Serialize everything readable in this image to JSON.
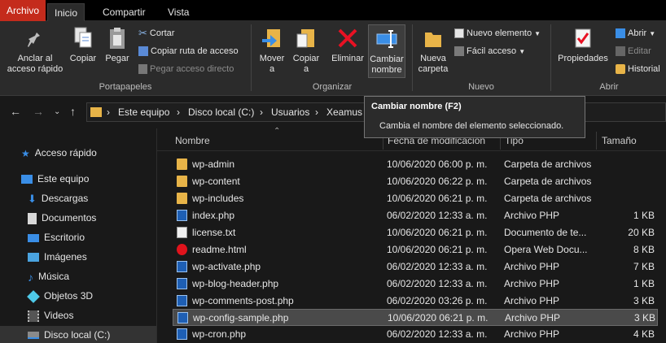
{
  "tabs": [
    "Archivo",
    "Inicio",
    "Compartir",
    "Vista"
  ],
  "ribbon": {
    "portapapeles": {
      "label": "Portapapeles",
      "anclar": "Anclar al acceso rápido",
      "copiar": "Copiar",
      "pegar": "Pegar",
      "cortar": "Cortar",
      "copiar_ruta": "Copiar ruta de acceso",
      "pegar_directo": "Pegar acceso directo"
    },
    "organizar": {
      "label": "Organizar",
      "mover": "Mover a",
      "copiar_a": "Copiar a",
      "eliminar": "Eliminar",
      "cambiar": "Cambiar nombre"
    },
    "nuevo": {
      "label": "Nuevo",
      "nueva_carpeta": "Nueva carpeta",
      "nuevo_elemento": "Nuevo elemento",
      "facil_acceso": "Fácil acceso"
    },
    "abrir": {
      "label": "Abrir",
      "propiedades": "Propiedades",
      "abrir": "Abrir",
      "editar": "Editar",
      "historial": "Historial"
    }
  },
  "address": {
    "crumbs": [
      "Este equipo",
      "Disco local (C:)",
      "Usuarios",
      "Xeamus"
    ]
  },
  "tooltip": {
    "title": "Cambiar nombre (F2)",
    "desc": "Cambia el nombre del elemento seleccionado."
  },
  "nav_pane": [
    {
      "label": "Acceso rápido",
      "icon": "star-icon"
    },
    {
      "label": "Este equipo",
      "icon": "pc-icon"
    },
    {
      "label": "Descargas",
      "icon": "download-icon"
    },
    {
      "label": "Documentos",
      "icon": "document-icon"
    },
    {
      "label": "Escritorio",
      "icon": "desktop-icon"
    },
    {
      "label": "Imágenes",
      "icon": "images-icon"
    },
    {
      "label": "Música",
      "icon": "music-icon"
    },
    {
      "label": "Objetos 3D",
      "icon": "cube-icon"
    },
    {
      "label": "Videos",
      "icon": "video-icon"
    },
    {
      "label": "Disco local (C:)",
      "icon": "drive-icon"
    }
  ],
  "columns": {
    "name": "Nombre",
    "date": "Fecha de modificación",
    "type": "Tipo",
    "size": "Tamaño"
  },
  "files": [
    {
      "name": "wp-admin",
      "date": "10/06/2020 06:00 p. m.",
      "type": "Carpeta de archivos",
      "size": "",
      "kind": "folder"
    },
    {
      "name": "wp-content",
      "date": "10/06/2020 06:22 p. m.",
      "type": "Carpeta de archivos",
      "size": "",
      "kind": "folder"
    },
    {
      "name": "wp-includes",
      "date": "10/06/2020 06:21 p. m.",
      "type": "Carpeta de archivos",
      "size": "",
      "kind": "folder"
    },
    {
      "name": "index.php",
      "date": "06/02/2020 12:33 a. m.",
      "type": "Archivo PHP",
      "size": "1 KB",
      "kind": "php"
    },
    {
      "name": "license.txt",
      "date": "10/06/2020 06:21 p. m.",
      "type": "Documento de te...",
      "size": "20 KB",
      "kind": "txt"
    },
    {
      "name": "readme.html",
      "date": "10/06/2020 06:21 p. m.",
      "type": "Opera Web Docu...",
      "size": "8 KB",
      "kind": "opera"
    },
    {
      "name": "wp-activate.php",
      "date": "06/02/2020 12:33 a. m.",
      "type": "Archivo PHP",
      "size": "7 KB",
      "kind": "php"
    },
    {
      "name": "wp-blog-header.php",
      "date": "06/02/2020 12:33 a. m.",
      "type": "Archivo PHP",
      "size": "1 KB",
      "kind": "php"
    },
    {
      "name": "wp-comments-post.php",
      "date": "06/02/2020 03:26 p. m.",
      "type": "Archivo PHP",
      "size": "3 KB",
      "kind": "php"
    },
    {
      "name": "wp-config-sample.php",
      "date": "10/06/2020 06:21 p. m.",
      "type": "Archivo PHP",
      "size": "3 KB",
      "kind": "php",
      "selected": true
    },
    {
      "name": "wp-cron.php",
      "date": "06/02/2020 12:33 a. m.",
      "type": "Archivo PHP",
      "size": "4 KB",
      "kind": "php"
    }
  ]
}
